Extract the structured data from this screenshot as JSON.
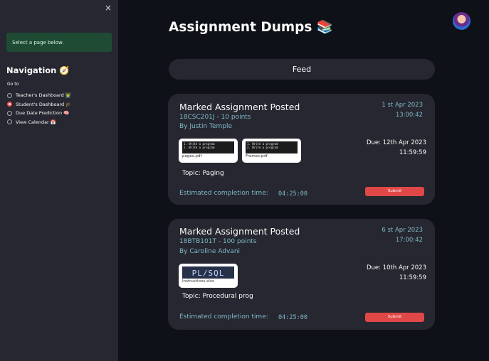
{
  "sidebar": {
    "close_label": "×",
    "info": "Select a page below.",
    "nav_title": "Navigation 🧭",
    "goto_label": "Go to",
    "options": [
      {
        "label": "Teacher's Dashboard 👨‍🏫",
        "selected": false
      },
      {
        "label": "Student's Dashboard 🎓",
        "selected": true
      },
      {
        "label": "Due Date Prediction 🧠",
        "selected": false
      },
      {
        "label": "View Calendar 📅",
        "selected": false
      }
    ]
  },
  "header": {
    "title": "Assignment Dumps 📚",
    "avatar_icon": "user-avatar-icon"
  },
  "tabs": {
    "feed_label": "Feed"
  },
  "cards": [
    {
      "title": "Marked Assignment Posted",
      "code": "18CSC201J - 10 points",
      "author": "By Justin Temple",
      "date": "1 st Apr 2023",
      "time": "13:00:42",
      "due_date": "Due: 12th Apr 2023",
      "due_time": "11:59:59",
      "attachments": [
        {
          "name": "pages.pdf",
          "preview": "1. Write a program\n2. Write a program"
        },
        {
          "name": "Frames.pdf",
          "preview": "1. Write a program\n2. Write a program"
        }
      ],
      "topic": "Topic: Paging",
      "est_label": "Estimated completion time:",
      "est_value": "04:25:00",
      "submit_label": "Submit"
    },
    {
      "title": "Marked Assignment Posted",
      "code": "18BTB101T - 100 points",
      "author": "By Caroline Advani",
      "date": "6 st Apr 2023",
      "time": "17:00:42",
      "due_date": "Due: 10th Apr 2023",
      "due_time": "11:59:59",
      "attachments": [
        {
          "name": "Instructions.xlsx",
          "preview": "PL/SQL"
        }
      ],
      "topic": "Topic: Procedural prog",
      "est_label": "Estimated completion time:",
      "est_value": "04:25:00",
      "submit_label": "Submit"
    }
  ]
}
